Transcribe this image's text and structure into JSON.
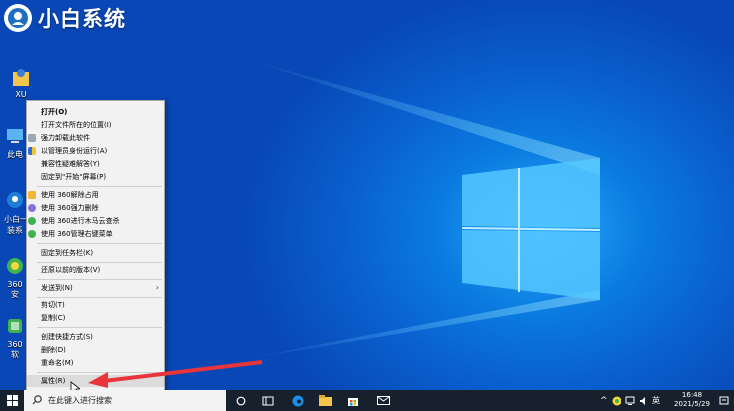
{
  "brand": {
    "text": "小白系统"
  },
  "desktop_icons": [
    {
      "label": "XU",
      "icon": "user-folder-icon"
    },
    {
      "label": "此电",
      "icon": "this-pc-icon"
    },
    {
      "label": "小白一\n装系",
      "icon": "xiaobai-icon"
    },
    {
      "label": "360安",
      "icon": "360-safe-icon"
    },
    {
      "label": "360软",
      "icon": "360-software-icon"
    }
  ],
  "context_menu": {
    "items": [
      {
        "label": "打开(O)",
        "bold": true
      },
      {
        "label": "打开文件所在的位置(I)"
      },
      {
        "label": "强力卸载此软件",
        "icon": "uninstall-icon"
      },
      {
        "label": "以管理员身份运行(A)",
        "icon": "shield-icon"
      },
      {
        "label": "兼容性疑难解答(Y)"
      },
      {
        "label": "固定到\"开始\"屏幕(P)"
      },
      {
        "label": "使用 360解除占用",
        "icon": "360-unlock-icon"
      },
      {
        "label": "使用 360强力删除",
        "icon": "360-delete-icon"
      },
      {
        "label": "使用 360进行木马云查杀",
        "icon": "360-scan-icon"
      },
      {
        "label": "使用 360管理右键菜单",
        "icon": "360-menu-icon"
      },
      {
        "label": "固定到任务栏(K)"
      },
      {
        "label": "还原以前的版本(V)"
      },
      {
        "label": "发送到(N)",
        "submenu": true
      },
      {
        "label": "剪切(T)"
      },
      {
        "label": "复制(C)"
      },
      {
        "label": "创建快捷方式(S)"
      },
      {
        "label": "删除(D)"
      },
      {
        "label": "重命名(M)"
      },
      {
        "label": "属性(R)",
        "hover": true
      }
    ]
  },
  "taskbar": {
    "search_placeholder": "在此键入进行搜索",
    "ime": "英",
    "time": "16:48",
    "date": "2021/5/29"
  },
  "colors": {
    "accent": "#0a6fd8",
    "arrow": "#e8343a",
    "taskbar": "#17202d"
  }
}
